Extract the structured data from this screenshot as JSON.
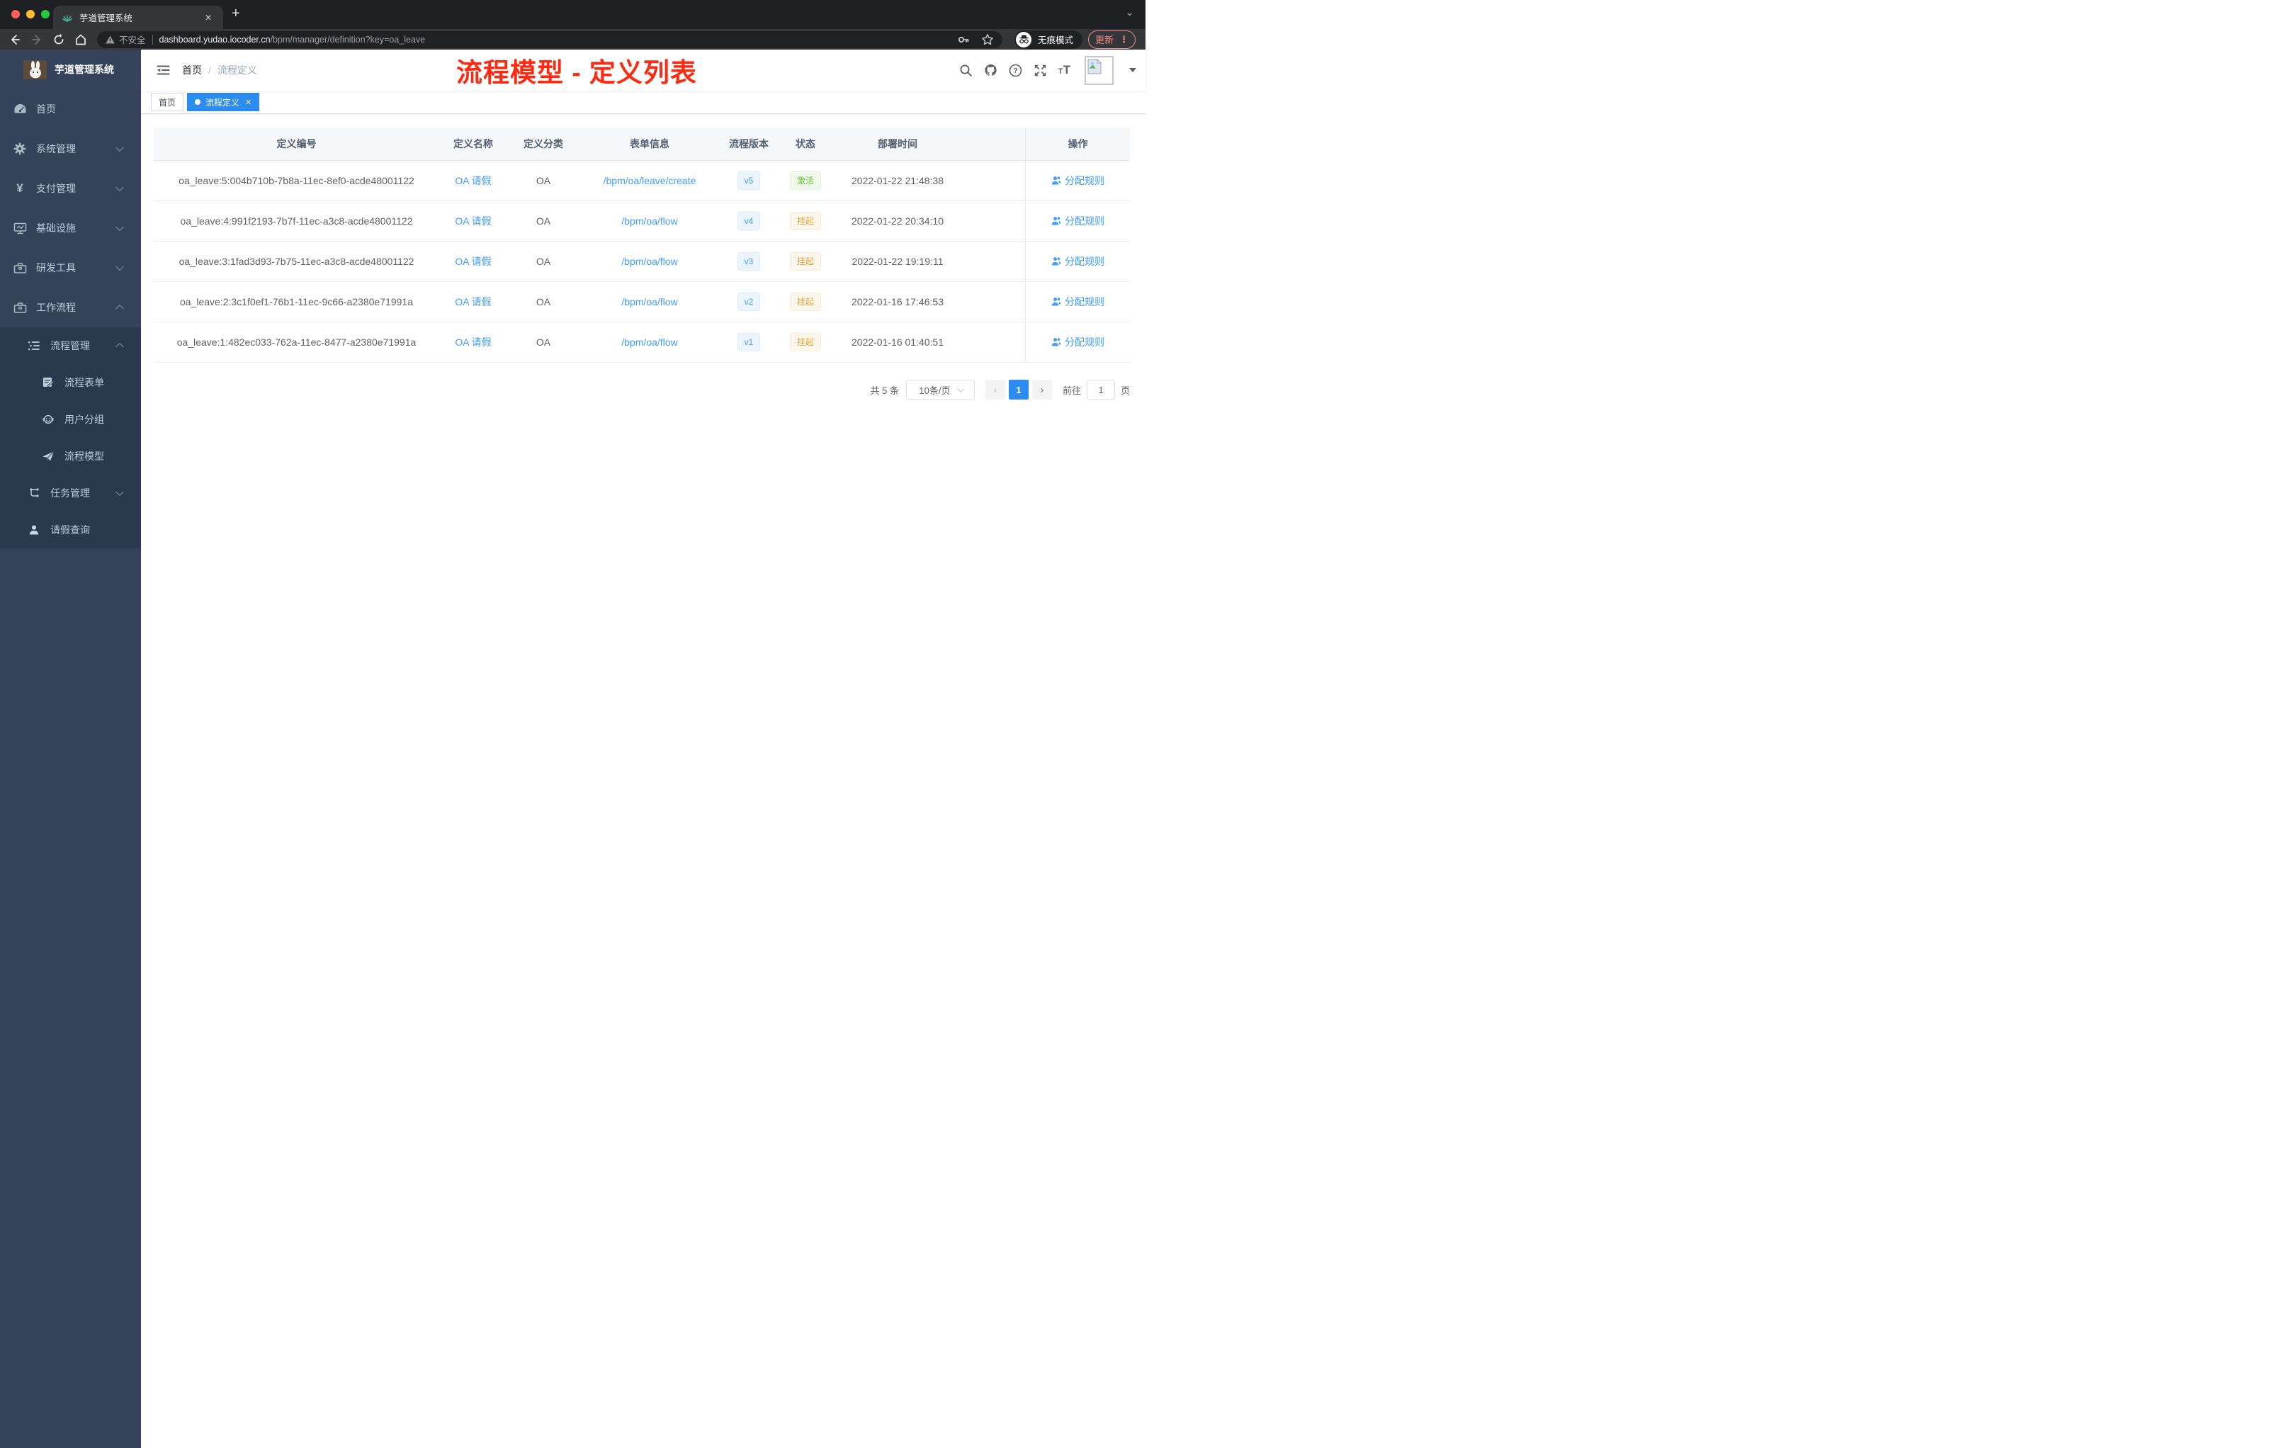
{
  "browser": {
    "tab_title": "芋道管理系统",
    "tab_close": "✕",
    "new_tab": "+",
    "url": {
      "security_label": "不安全",
      "host": "dashboard.yudao.iocoder.cn",
      "path": "/bpm/manager/definition?key=oa_leave"
    },
    "incognito_label": "无痕模式",
    "update_label": "更新",
    "menu_dots": "⋮"
  },
  "sidebar": {
    "logo_title": "芋道管理系统",
    "items": [
      {
        "label": "首页",
        "icon": "dashboard-icon"
      },
      {
        "label": "系统管理",
        "icon": "gear-icon",
        "arrow": "down"
      },
      {
        "label": "支付管理",
        "icon": "yen-icon",
        "arrow": "down"
      },
      {
        "label": "基础设施",
        "icon": "monitor-icon",
        "arrow": "down"
      },
      {
        "label": "研发工具",
        "icon": "toolbox-icon",
        "arrow": "down"
      },
      {
        "label": "工作流程",
        "icon": "briefcase-icon",
        "arrow": "up"
      }
    ],
    "submenu": [
      {
        "label": "流程管理",
        "icon": "list-tree-icon",
        "arrow": "up"
      },
      {
        "label": "流程表单",
        "icon": "form-icon"
      },
      {
        "label": "用户分组",
        "icon": "user-group-icon"
      },
      {
        "label": "流程模型",
        "icon": "paper-plane-icon"
      },
      {
        "label": "任务管理",
        "icon": "tasks-icon",
        "arrow": "down"
      },
      {
        "label": "请假查询",
        "icon": "person-icon"
      }
    ]
  },
  "navbar": {
    "breadcrumb": {
      "home": "首页",
      "separator": "/",
      "current": "流程定义"
    },
    "annotation": "流程模型 - 定义列表",
    "annotation_color": "#fb2a10"
  },
  "tags": {
    "home": "首页",
    "active": "流程定义",
    "close": "✕"
  },
  "table": {
    "columns": [
      "定义编号",
      "定义名称",
      "定义分类",
      "表单信息",
      "流程版本",
      "状态",
      "部署时间",
      "操作"
    ],
    "action_label": "分配规则",
    "rows": [
      {
        "id": "oa_leave:5:004b710b-7b8a-11ec-8ef0-acde48001122",
        "name": "OA 请假",
        "category": "OA",
        "form": "/bpm/oa/leave/create",
        "version": "v5",
        "status": "激活",
        "status_type": "success",
        "time": "2022-01-22 21:48:38"
      },
      {
        "id": "oa_leave:4:991f2193-7b7f-11ec-a3c8-acde48001122",
        "name": "OA 请假",
        "category": "OA",
        "form": "/bpm/oa/flow",
        "version": "v4",
        "status": "挂起",
        "status_type": "warning",
        "time": "2022-01-22 20:34:10"
      },
      {
        "id": "oa_leave:3:1fad3d93-7b75-11ec-a3c8-acde48001122",
        "name": "OA 请假",
        "category": "OA",
        "form": "/bpm/oa/flow",
        "version": "v3",
        "status": "挂起",
        "status_type": "warning",
        "time": "2022-01-22 19:19:11"
      },
      {
        "id": "oa_leave:2:3c1f0ef1-76b1-11ec-9c66-a2380e71991a",
        "name": "OA 请假",
        "category": "OA",
        "form": "/bpm/oa/flow",
        "version": "v2",
        "status": "挂起",
        "status_type": "warning",
        "time": "2022-01-16 17:46:53"
      },
      {
        "id": "oa_leave:1:482ec033-762a-11ec-8477-a2380e71991a",
        "name": "OA 请假",
        "category": "OA",
        "form": "/bpm/oa/flow",
        "version": "v1",
        "status": "挂起",
        "status_type": "warning",
        "time": "2022-01-16 01:40:51"
      }
    ]
  },
  "pagination": {
    "total": "共 5 条",
    "page_size": "10条/页",
    "prev": "‹",
    "page": "1",
    "next": "›",
    "goto_label": "前往",
    "goto_value": "1",
    "unit": "页"
  },
  "colors": {
    "primary_link": "#409eff",
    "tag_active": "#2d8cf0",
    "success": "#67c23a",
    "warning": "#e6a23c",
    "sidebar_bg": "#35435a",
    "submenu_bg": "#2b394e",
    "annotation_red": "#fb2a10",
    "chrome_dark": "#202124",
    "update_pill": "#f28b82"
  }
}
